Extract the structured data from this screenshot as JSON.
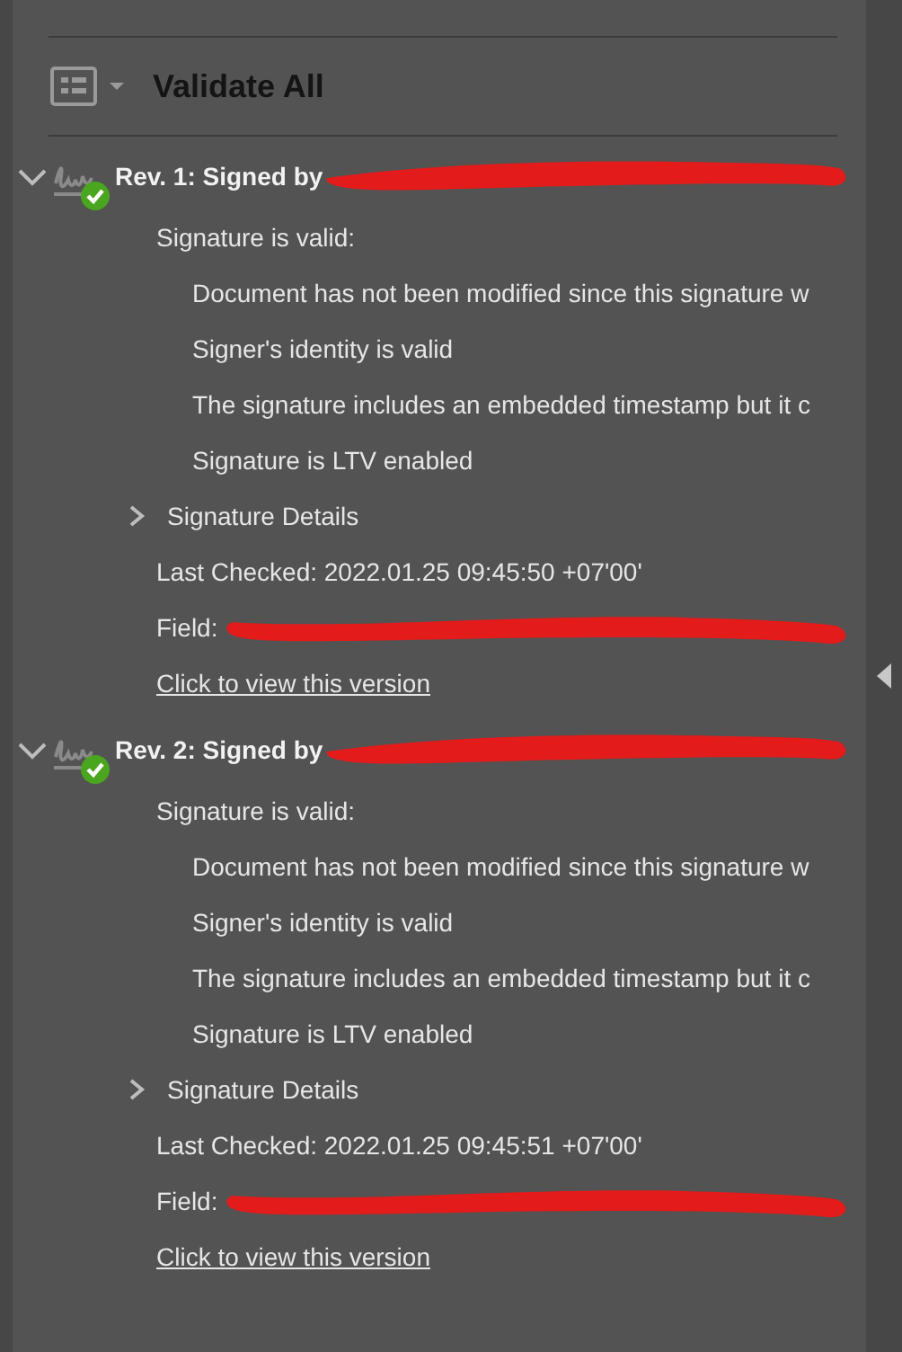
{
  "toolbar": {
    "validate_label": "Validate All"
  },
  "signatures": [
    {
      "title": "Rev. 1: Signed by",
      "title_redacted": true,
      "expanded": true,
      "valid": true,
      "status": "Signature is valid:",
      "checks": [
        "Document has not been modified since this signature w",
        "Signer's identity is valid",
        "The signature includes an embedded timestamp but it c",
        "Signature is LTV enabled"
      ],
      "details": {
        "label": "Signature Details",
        "expanded": false
      },
      "last_checked": "Last Checked: 2022.01.25 09:45:50 +07'00'",
      "field": "Field:",
      "field_redacted": true,
      "link": "Click to view this version"
    },
    {
      "title": "Rev. 2: Signed by",
      "title_redacted": true,
      "expanded": true,
      "valid": true,
      "status": "Signature is valid:",
      "checks": [
        "Document has not been modified since this signature w",
        "Signer's identity is valid",
        "The signature includes an embedded timestamp but it c",
        "Signature is LTV enabled"
      ],
      "details": {
        "label": "Signature Details",
        "expanded": false
      },
      "last_checked": "Last Checked: 2022.01.25 09:45:51 +07'00'",
      "field": "Field:",
      "field_redacted": true,
      "link": "Click to view this version"
    }
  ]
}
